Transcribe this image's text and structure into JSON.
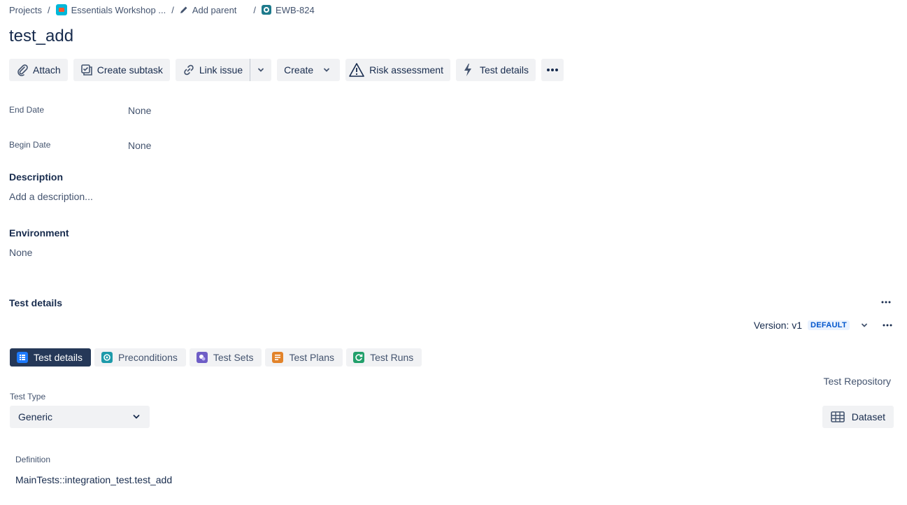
{
  "breadcrumb": {
    "projects": "Projects",
    "project_name": "Essentials Workshop ...",
    "add_parent": "Add parent",
    "issue_key": "EWB-824",
    "separator": "/"
  },
  "issue": {
    "title": "test_add"
  },
  "toolbar": {
    "attach": "Attach",
    "create_subtask": "Create subtask",
    "link_issue": "Link issue",
    "create": "Create",
    "risk_assessment": "Risk assessment",
    "test_details": "Test details"
  },
  "fields": {
    "end_date_label": "End Date",
    "end_date_value": "None",
    "begin_date_label": "Begin Date",
    "begin_date_value": "None",
    "description_label": "Description",
    "description_placeholder": "Add a description...",
    "environment_label": "Environment",
    "environment_value": "None"
  },
  "test_details": {
    "heading": "Test details",
    "version_label": "Version: v1",
    "version_badge": "DEFAULT",
    "tabs": [
      {
        "label": "Test details",
        "active": true,
        "color": "#1d7afc"
      },
      {
        "label": "Preconditions",
        "active": false,
        "color": "#1d9aaa"
      },
      {
        "label": "Test Sets",
        "active": false,
        "color": "#6e5dc6"
      },
      {
        "label": "Test Plans",
        "active": false,
        "color": "#e2832a"
      },
      {
        "label": "Test Runs",
        "active": false,
        "color": "#22a06b"
      }
    ],
    "test_repository": "Test Repository",
    "test_type_label": "Test Type",
    "test_type_value": "Generic",
    "dataset_button": "Dataset",
    "definition_label": "Definition",
    "definition_value": "MainTests::integration_test.test_add"
  },
  "colors": {
    "text": "#172b4d",
    "subtle": "#44546f",
    "button_bg": "#f1f2f4",
    "active_tab": "#253858",
    "badge_bg": "#e9f2ff",
    "badge_text": "#0055cc"
  }
}
